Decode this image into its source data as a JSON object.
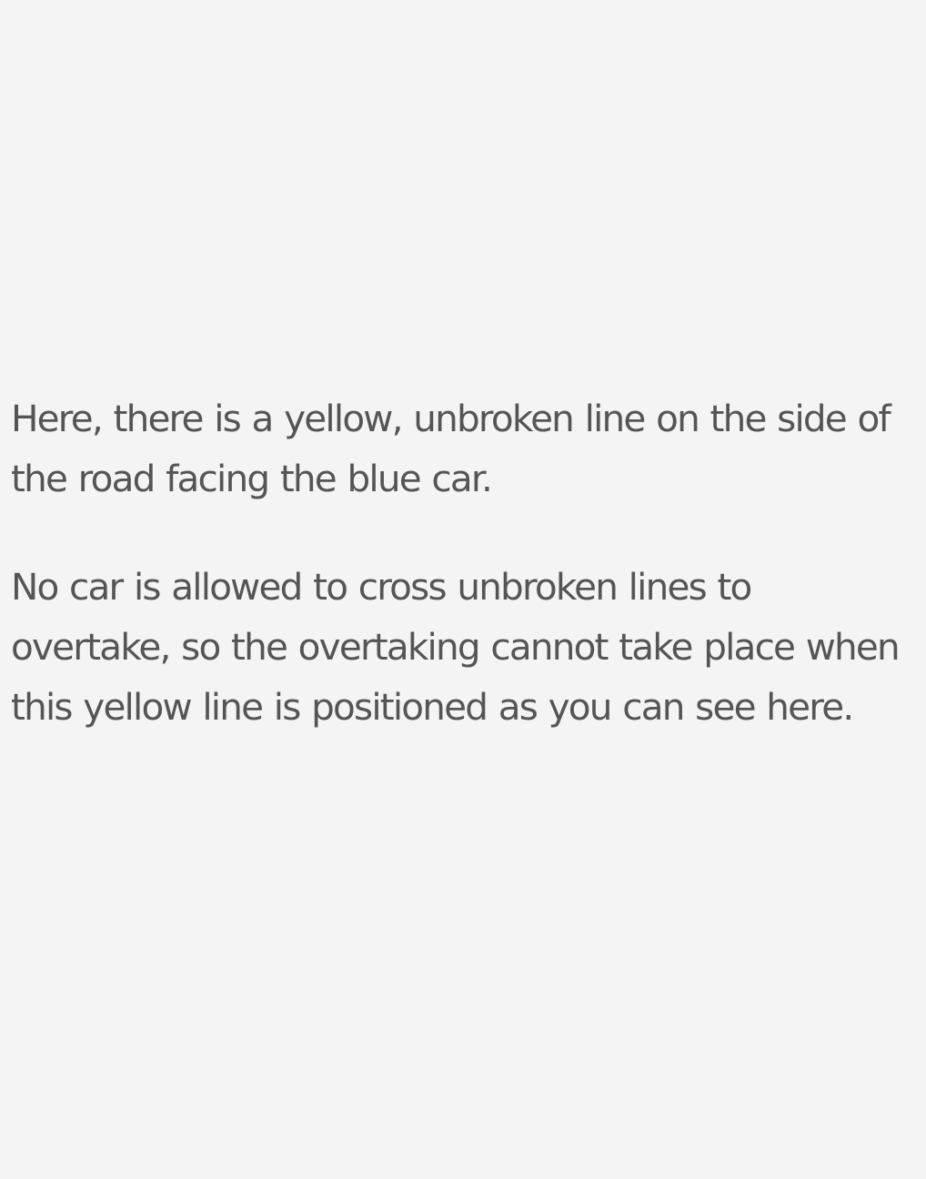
{
  "colors": {
    "background": "#f4f4f4",
    "text": "#555555"
  },
  "paragraphs": [
    "Here, there is a yellow, unbroken line on the side of the road facing the blue car.",
    "No car is allowed to cross unbroken lines to overtake, so the overtaking cannot take place when this yellow line is positioned as you can see here."
  ]
}
